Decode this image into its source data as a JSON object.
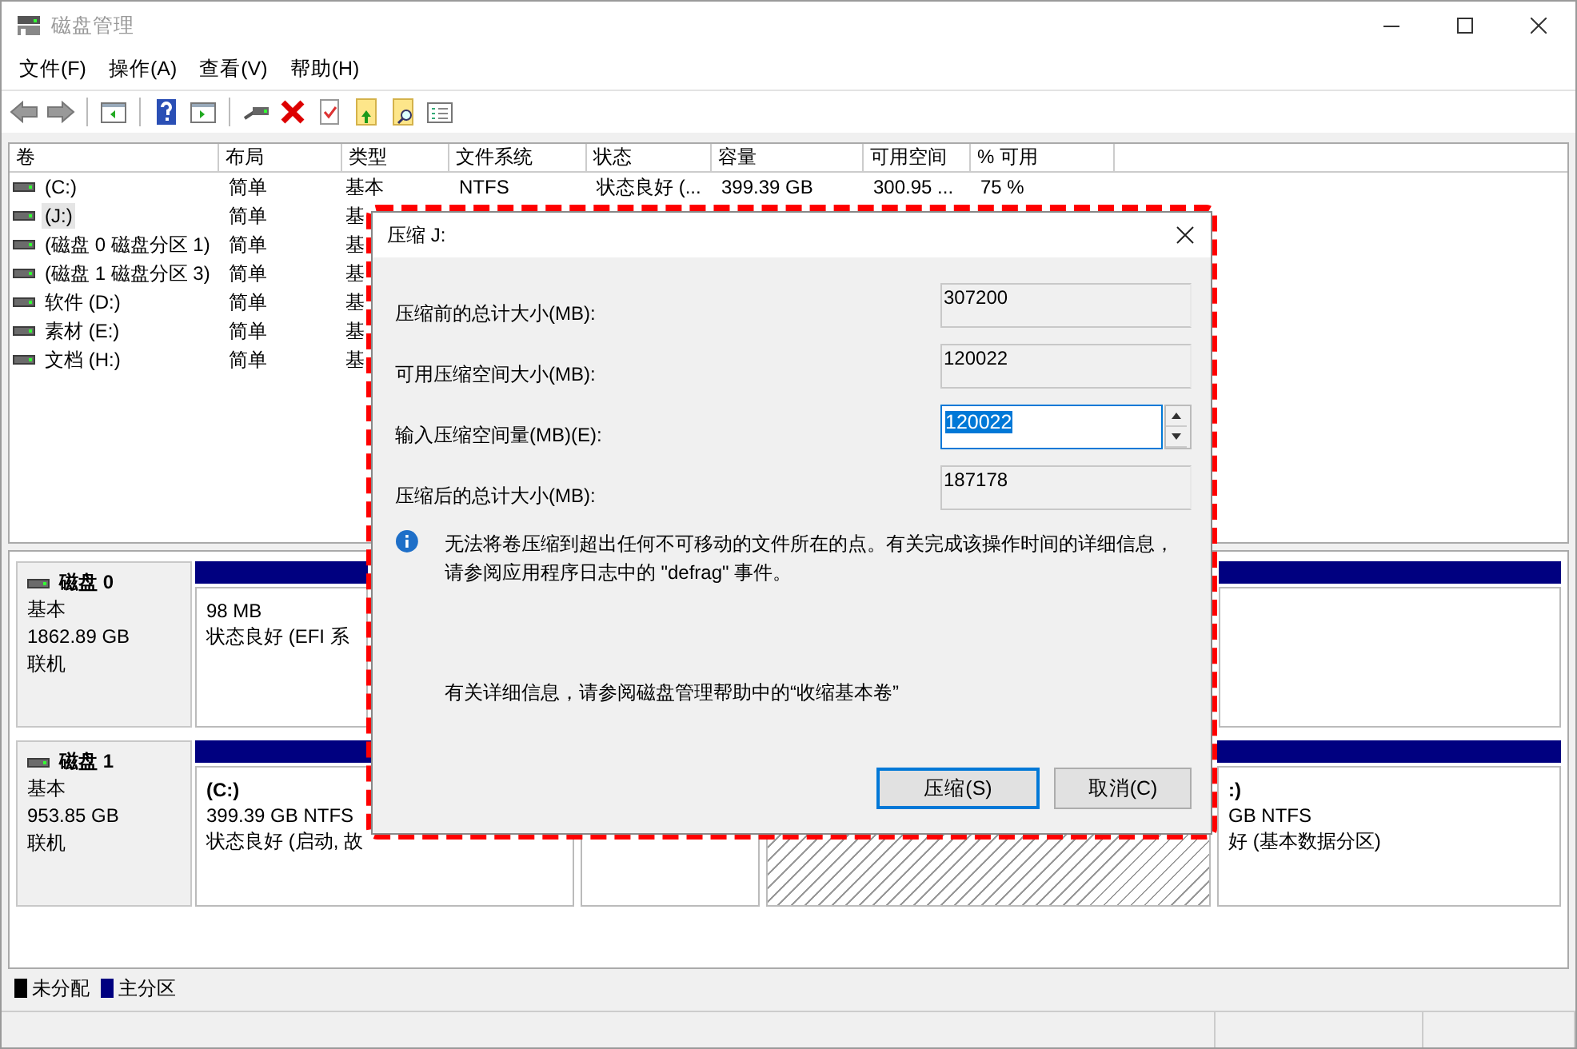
{
  "window": {
    "title": "磁盘管理"
  },
  "menu": [
    "文件(F)",
    "操作(A)",
    "查看(V)",
    "帮助(H)"
  ],
  "volume_list": {
    "columns": [
      "卷",
      "布局",
      "类型",
      "文件系统",
      "状态",
      "容量",
      "可用空间",
      "% 可用"
    ],
    "rows": [
      {
        "cells": [
          "(C:)",
          "简单",
          "基本",
          "NTFS",
          "状态良好 (...",
          "399.39 GB",
          "300.95 ...",
          "75 %"
        ],
        "selected": false
      },
      {
        "cells": [
          "(J:)",
          "简单",
          "基"
        ],
        "selected": true
      },
      {
        "cells": [
          "(磁盘 0 磁盘分区 1)",
          "简单",
          "基"
        ],
        "selected": false
      },
      {
        "cells": [
          "(磁盘 1 磁盘分区 3)",
          "简单",
          "基"
        ],
        "selected": false
      },
      {
        "cells": [
          "软件 (D:)",
          "简单",
          "基"
        ],
        "selected": false
      },
      {
        "cells": [
          "素材 (E:)",
          "简单",
          "基"
        ],
        "selected": false
      },
      {
        "cells": [
          "文档 (H:)",
          "简单",
          "基"
        ],
        "selected": false
      }
    ]
  },
  "disks": [
    {
      "name": "磁盘 0",
      "type": "基本",
      "size": "1862.89 GB",
      "status": "联机",
      "partitions": [
        {
          "kind": "primary",
          "lines": [
            "98 MB",
            "状态良好 (EFI 系"
          ]
        },
        {
          "kind": "primary"
        }
      ]
    },
    {
      "name": "磁盘 1",
      "type": "基本",
      "size": "953.85 GB",
      "status": "联机",
      "partitions": [
        {
          "kind": "primary",
          "title": "(C:)",
          "lines": [
            "399.39 GB NTFS",
            "状态良好 (启动, 故"
          ]
        },
        {
          "kind": "primary"
        },
        {
          "kind": "unallocated"
        },
        {
          "kind": "primary",
          "title": ":)",
          "lines": [
            "GB NTFS",
            "好 (基本数据分区)"
          ]
        }
      ]
    }
  ],
  "legend": [
    {
      "label": "未分配",
      "color": "#000000"
    },
    {
      "label": "主分区",
      "color": "#000080"
    }
  ],
  "dialog": {
    "title": "压缩 J:",
    "fields": [
      {
        "kind": "readonly",
        "label": "压缩前的总计大小(MB):",
        "value": "307200"
      },
      {
        "kind": "readonly",
        "label": "可用压缩空间大小(MB):",
        "value": "120022"
      },
      {
        "kind": "spin",
        "label": "输入压缩空间量(MB)(E):",
        "value": "120022"
      },
      {
        "kind": "readonly",
        "label": "压缩后的总计大小(MB):",
        "value": "187178"
      }
    ],
    "info": "无法将卷压缩到超出任何不可移动的文件所在的点。有关完成该操作时间的详细信息，请参阅应用程序日志中的 \"defrag\" 事件。",
    "help": "有关详细信息，请参阅磁盘管理帮助中的“收缩基本卷”",
    "buttons": [
      {
        "label": "压缩(S)",
        "default": true
      },
      {
        "label": "取消(C)",
        "default": false
      }
    ]
  }
}
